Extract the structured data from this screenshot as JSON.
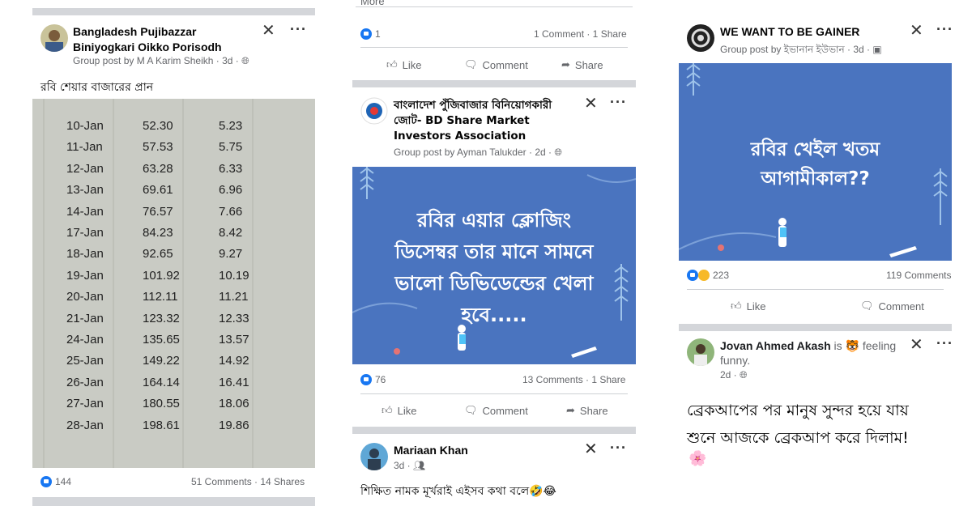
{
  "post1": {
    "group_name": "Bangladesh Pujibazzar Biniyogkari Oikko Porisodh",
    "subtitle": "Group post by M A Karim Sheikh · 3d ·",
    "text": "রবি শেয়ার বাজারের প্রান",
    "table_rows": [
      {
        "date": "10-Jan",
        "price": "52.30",
        "change": "5.23"
      },
      {
        "date": "11-Jan",
        "price": "57.53",
        "change": "5.75"
      },
      {
        "date": "12-Jan",
        "price": "63.28",
        "change": "6.33"
      },
      {
        "date": "13-Jan",
        "price": "69.61",
        "change": "6.96"
      },
      {
        "date": "14-Jan",
        "price": "76.57",
        "change": "7.66"
      },
      {
        "date": "17-Jan",
        "price": "84.23",
        "change": "8.42"
      },
      {
        "date": "18-Jan",
        "price": "92.65",
        "change": "9.27"
      },
      {
        "date": "19-Jan",
        "price": "101.92",
        "change": "10.19"
      },
      {
        "date": "20-Jan",
        "price": "112.11",
        "change": "11.21"
      },
      {
        "date": "21-Jan",
        "price": "123.32",
        "change": "12.33"
      },
      {
        "date": "24-Jan",
        "price": "135.65",
        "change": "13.57"
      },
      {
        "date": "25-Jan",
        "price": "149.22",
        "change": "14.92"
      },
      {
        "date": "26-Jan",
        "price": "164.14",
        "change": "16.41"
      },
      {
        "date": "27-Jan",
        "price": "180.55",
        "change": "18.06"
      },
      {
        "date": "28-Jan",
        "price": "198.61",
        "change": "19.86"
      }
    ],
    "reactions": "144",
    "comments_shares": "51 Comments · 14 Shares"
  },
  "post2_top": {
    "more": "More",
    "reactions": "1",
    "comments_shares": "1 Comment · 1 Share",
    "like": "Like",
    "comment": "Comment",
    "share": "Share"
  },
  "post2": {
    "group_name": "বাংলাদেশ পুঁজিবাজার বিনিয়োগকারী জোট- BD Share Market Investors Association",
    "subtitle": "Group post by Ayman Talukder · 2d ·",
    "banner_lines": [
      "রবির এয়ার ক্লোজিং",
      "ডিসেম্বর তার মানে সামনে",
      "ভালো ডিভিডেন্ডের খেলা",
      "হবে....."
    ],
    "reactions": "76",
    "comments_shares": "13 Comments · 1 Share",
    "like": "Like",
    "comment": "Comment",
    "share": "Share"
  },
  "post3": {
    "author": "Mariaan Khan",
    "subtitle": "3d ·",
    "text": "শিক্ষিত নামক মূর্খরাই এইসব কথা বলে🤣😂"
  },
  "post4": {
    "group_name": "WE WANT TO BE GAINER",
    "subtitle": "Group post by ইভানান ইউভান · 3d ·",
    "banner_lines": [
      "রবির খেইল খতম",
      "আগামীকাল??"
    ],
    "reactions": "223",
    "comments": "119 Comments",
    "like": "Like",
    "comment": "Comment"
  },
  "post5": {
    "author": "Jovan Ahmed Akash",
    "feeling": " is 🐯 feeling funny.",
    "subtitle": "2d ·",
    "text_line1": "ব্রেকআপের পর মানুষ সুন্দর হয়ে যায়",
    "text_line2": "শুনে আজকে ব্রেকআপ করে দিলাম!",
    "emoji": "🌸"
  },
  "colors": {
    "facebook_blue": "#1877f2",
    "banner_blue": "#4a74bf",
    "meta_gray": "#65676b"
  }
}
